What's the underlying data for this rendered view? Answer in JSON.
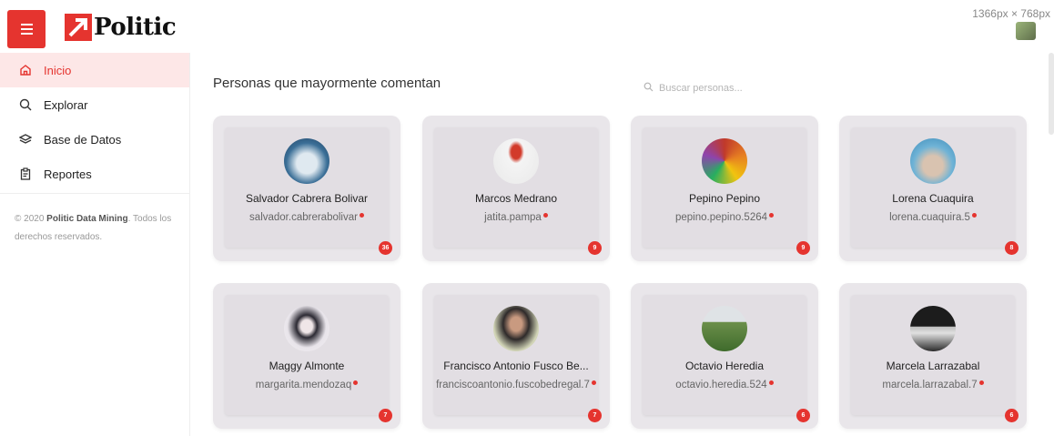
{
  "app": {
    "brand": "Politic",
    "screen_dims": "1366px × 768px"
  },
  "colors": {
    "accent": "#e5342f",
    "card_bg": "#e9e6ea",
    "active_bg": "#fde7e7"
  },
  "sidebar": {
    "items": [
      {
        "label": "Inicio",
        "icon": "home-icon",
        "active": true
      },
      {
        "label": "Explorar",
        "icon": "search-icon",
        "active": false
      },
      {
        "label": "Base de Datos",
        "icon": "layers-icon",
        "active": false
      },
      {
        "label": "Reportes",
        "icon": "clipboard-icon",
        "active": false
      }
    ],
    "footer_prefix": "© 2020 ",
    "footer_brand": "Politic Data Mining",
    "footer_suffix": ". Todos los derechos reservados."
  },
  "main": {
    "title": "Personas que mayormente comentan",
    "search_placeholder": "Buscar personas..."
  },
  "people": [
    {
      "name": "Salvador Cabrera Bolivar",
      "username": "salvador.cabrerabolivar",
      "count": "36"
    },
    {
      "name": "Marcos Medrano",
      "username": "jatita.pampa",
      "count": "9"
    },
    {
      "name": "Pepino Pepino",
      "username": "pepino.pepino.5264",
      "count": "9"
    },
    {
      "name": "Lorena Cuaquira",
      "username": "lorena.cuaquira.5",
      "count": "8"
    },
    {
      "name": "Maggy Almonte",
      "username": "margarita.mendozaq",
      "count": "7"
    },
    {
      "name": "Francisco Antonio Fusco Be...",
      "username": "franciscoantonio.fuscobedregal.7",
      "count": "7"
    },
    {
      "name": "Octavio Heredia",
      "username": "octavio.heredia.524",
      "count": "6"
    },
    {
      "name": "Marcela Larrazabal",
      "username": "marcela.larrazabal.7",
      "count": "6"
    }
  ]
}
